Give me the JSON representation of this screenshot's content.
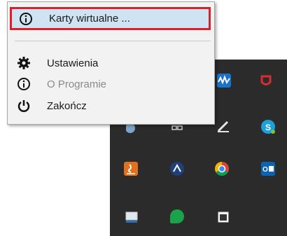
{
  "context_menu": {
    "items": [
      {
        "label": "Karty wirtualne ...",
        "icon": "info-icon",
        "highlighted": true,
        "enabled": true
      },
      {
        "label": "Ustawienia",
        "icon": "gear-icon",
        "enabled": true
      },
      {
        "label": "O Programie",
        "icon": "info-icon",
        "enabled": false
      },
      {
        "label": "Zakończ",
        "icon": "power-icon",
        "enabled": true
      }
    ]
  },
  "colors": {
    "highlight_border": "#d9202b",
    "highlight_fill": "#cfe3f2",
    "tray_background": "#2b2b2b"
  },
  "tray": {
    "icons": [
      "network-monitor-icon",
      "antivirus-icon",
      "cloud-icon",
      "network-icon",
      "pen-icon",
      "skype-icon",
      "java-icon",
      "app-icon",
      "chrome-icon",
      "outlook-icon",
      "display-icon",
      "evernote-icon",
      "window-icon"
    ]
  }
}
